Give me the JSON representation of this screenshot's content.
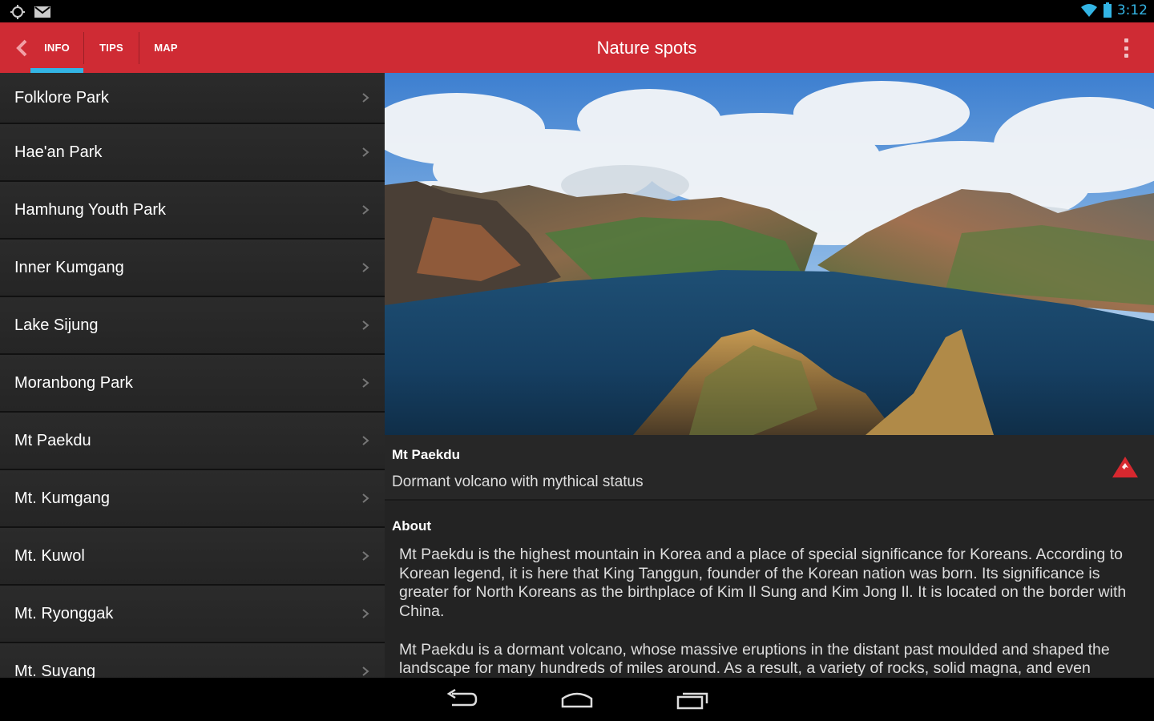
{
  "status_bar": {
    "time": "3:12",
    "left_icons": [
      "sync-icon",
      "gmail-icon"
    ],
    "right_icons": [
      "wifi-icon",
      "battery-icon"
    ],
    "accent_color": "#33b5e5"
  },
  "action_bar": {
    "background": "#cf2b34",
    "back_icon": "back-chevron-icon",
    "tabs": [
      {
        "label": "INFO",
        "selected": true
      },
      {
        "label": "TIPS",
        "selected": false
      },
      {
        "label": "MAP",
        "selected": false
      }
    ],
    "title": "Nature spots",
    "overflow_icon": "overflow-menu-icon"
  },
  "list": {
    "items": [
      {
        "label": "Folklore Park"
      },
      {
        "label": "Hae'an Park"
      },
      {
        "label": "Hamhung Youth Park"
      },
      {
        "label": "Inner Kumgang"
      },
      {
        "label": "Lake Sijung"
      },
      {
        "label": "Moranbong Park"
      },
      {
        "label": "Mt Paekdu"
      },
      {
        "label": "Mt. Kumgang"
      },
      {
        "label": "Mt. Kuwol"
      },
      {
        "label": "Mt. Ryonggak"
      },
      {
        "label": "Mt. Suyang"
      }
    ],
    "chevron_icon": "chevron-right-icon"
  },
  "detail": {
    "image": "crater-lake-photo",
    "name": "Mt Paekdu",
    "subtitle": "Dormant volcano with mythical status",
    "category_icon": "mountain-icon",
    "about_heading": "About",
    "about_paragraphs": [
      "Mt Paekdu is the highest mountain in Korea and a place of special significance for Koreans. According to Korean legend, it is here that King Tanggun, founder of the Korean nation was born. Its significance is greater for North Koreans as the birthplace of Kim Il Sung and Kim Jong Il. It is located on the border with China.",
      "Mt Paekdu is a dormant volcano, whose massive eruptions in the distant past moulded and shaped the landscape for many hundreds of miles around. As a result, a variety of rocks, solid magna, and even"
    ]
  },
  "nav_bar": {
    "buttons": [
      "back-icon",
      "home-icon",
      "recent-apps-icon"
    ]
  }
}
